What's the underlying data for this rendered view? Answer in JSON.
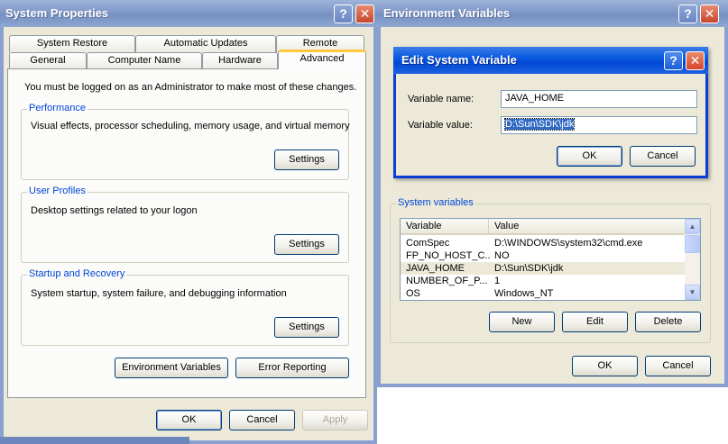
{
  "system_properties": {
    "title": "System Properties",
    "help_glyph": "?",
    "close_glyph": "✕",
    "tabs_row1": [
      "System Restore",
      "Automatic Updates",
      "Remote"
    ],
    "tabs_row2": [
      "General",
      "Computer Name",
      "Hardware",
      "Advanced"
    ],
    "admin_notice": "You must be logged on as an Administrator to make most of these changes.",
    "performance": {
      "label": "Performance",
      "description": "Visual effects, processor scheduling, memory usage, and virtual memory",
      "button": "Settings"
    },
    "user_profiles": {
      "label": "User Profiles",
      "description": "Desktop settings related to your logon",
      "button": "Settings"
    },
    "startup": {
      "label": "Startup and Recovery",
      "description": "System startup, system failure, and debugging information",
      "button": "Settings"
    },
    "env_button": "Environment Variables",
    "error_button": "Error Reporting",
    "ok": "OK",
    "cancel": "Cancel",
    "apply": "Apply"
  },
  "env_vars": {
    "title": "Environment Variables",
    "help_glyph": "?",
    "close_glyph": "✕",
    "system_label": "System variables",
    "columns": [
      "Variable",
      "Value"
    ],
    "rows": [
      {
        "variable": "ComSpec",
        "value": "D:\\WINDOWS\\system32\\cmd.exe"
      },
      {
        "variable": "FP_NO_HOST_C...",
        "value": "NO"
      },
      {
        "variable": "JAVA_HOME",
        "value": "D:\\Sun\\SDK\\jdk"
      },
      {
        "variable": "NUMBER_OF_P...",
        "value": "1"
      },
      {
        "variable": "OS",
        "value": "Windows_NT"
      }
    ],
    "selected_row": 2,
    "new": "New",
    "edit": "Edit",
    "delete": "Delete",
    "ok": "OK",
    "cancel": "Cancel"
  },
  "edit_dialog": {
    "title": "Edit System Variable",
    "help_glyph": "?",
    "close_glyph": "✕",
    "name_label": "Variable name:",
    "name_value": "JAVA_HOME",
    "value_label": "Variable value:",
    "value_value": "D:\\Sun\\SDK\\jdk",
    "ok": "OK",
    "cancel": "Cancel"
  }
}
